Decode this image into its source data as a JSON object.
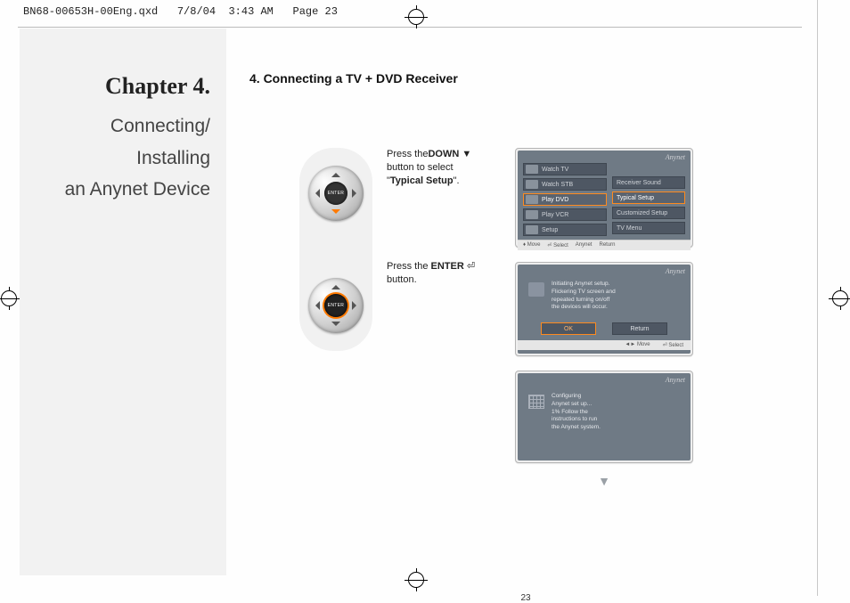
{
  "meta": {
    "file": "BN68-00653H-00Eng.qxd",
    "date": "7/8/04",
    "time": "3:43 AM",
    "page_label": "Page 23"
  },
  "sidebar": {
    "chapter": "Chapter 4.",
    "line1": "Connecting/",
    "line2": "Installing",
    "line3": "an Anynet Device"
  },
  "section_title": "4. Connecting a TV + DVD Receiver",
  "step1": {
    "pre": "Press the",
    "key": "DOWN",
    "mid": "button to select",
    "target": "Typical Setup",
    "post": "\"."
  },
  "step2": {
    "pre": "Press the ",
    "key": "ENTER",
    "post": "button."
  },
  "dpad_center": "ENTER",
  "screen1": {
    "logo": "Anynet",
    "left_items": [
      "Watch TV",
      "Watch STB",
      "Play DVD",
      "Play VCR",
      "Setup"
    ],
    "right_items": [
      "Receiver Sound",
      "Typical Setup",
      "Customized Setup",
      "TV Menu"
    ],
    "selected_left_index": 2,
    "selected_right_index": 1,
    "footer": [
      "Move",
      "Select",
      "Anynet",
      "Return"
    ]
  },
  "screen2": {
    "logo": "Anynet",
    "msg1": "Initiating Anynet setup.",
    "msg2": "Flickering TV screen and",
    "msg3": "repeated turning on/off",
    "msg4": "the devices will occur.",
    "ok": "OK",
    "return": "Return",
    "footer": [
      "Move",
      "Select"
    ]
  },
  "screen3": {
    "logo": "Anynet",
    "l1": "Configuring",
    "l2": "Anynet set up...",
    "l3": "1% Follow the",
    "l4": "instructions to run",
    "l5": "the Anynet system."
  },
  "continue_glyph": "▼",
  "page_number": "23"
}
